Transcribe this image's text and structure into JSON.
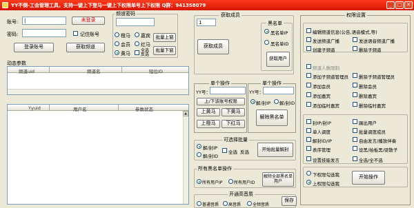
{
  "titlebar": {
    "title": "YY不倒-工会管理工具，支持一键上下登马一键上下权限单号上下权限 Q群：941358079",
    "min_icon": "minimize-icon",
    "max_icon": "maximize-icon",
    "close_icon": "close-icon"
  },
  "login": {
    "account_label": "账号:",
    "password_label": "密码:",
    "account_value": "|",
    "status": "未登录",
    "remember": "记住账号",
    "login_btn": "登录账号",
    "get_channel_btn": "获取频道"
  },
  "channel": {
    "group_title": "频道密码",
    "radios": [
      "橙马",
      "红马",
      "会员",
      "嘉宾",
      "黄马",
      "全选反选"
    ],
    "batch_up": "批量上窗",
    "batch_down": "批量下窗"
  },
  "members": {
    "group_title": "获取成员",
    "id_value": "1",
    "get_btn": "获取成员",
    "blacklist_title": "黑名单",
    "blacklist_ip": "黑名单IP",
    "blacklist_id": "黑名单ID",
    "get_users_btn": "获取用户"
  },
  "dynamic": {
    "title": "动态参数",
    "cols": [
      "频道uid",
      "频道名",
      "短位ID"
    ]
  },
  "lower": {
    "cols": [
      "Yyuid",
      "用户名",
      "参数状态"
    ]
  },
  "single1": {
    "title": "单个操作",
    "yy_label": "YY号：",
    "up_down_btn": "上/下该账号权限",
    "up_horse": "上黄马",
    "down_horse": "下黄马",
    "up_red": "上橙马",
    "down_red": "下红马"
  },
  "single2": {
    "title": "单个操作",
    "yy_label": "YY号：",
    "radio1": "解/封IP",
    "radio2": "解/封ID",
    "unblock_btn": "解除黑名单"
  },
  "batch": {
    "title": "可选择批量",
    "radio1": "解/封IP",
    "radio2": "解/封ID",
    "select_all": "全选",
    "invert": "反选",
    "start_btn": "开始批量解封"
  },
  "all_black": {
    "title": "所有黑名单操作",
    "radio1": "所有用户IP",
    "radio2": "所有用户ID",
    "unblock_all_btn": "解除全部黑名单用户"
  },
  "quality": {
    "title": "开通高音质",
    "radio1": "普通音质",
    "radio2": "高音质",
    "radio3": "全频音质",
    "save_btn": "保存"
  },
  "permissions": {
    "title": "权限设置",
    "top_checks": [
      "编辑频道信息(公告,语音模式,等)",
      "发送频道广播",
      "发送语音频道广播",
      "创建子频道",
      "删除子频道"
    ],
    "sub_title": "频道人数限制",
    "sub_checks": [
      "添加子频道管理员",
      "删除子频道管理员",
      "添加会员",
      "删除会员",
      "添加嘉宾",
      "删除嘉宾",
      "添加临时嘉宾",
      "删除临时嘉宾"
    ],
    "ops_checks": [
      "封IP/封IP",
      "踢出用户",
      "单人调度",
      "批量调度成员",
      "解封ID/IP",
      "自由发言/播放伴奏",
      "表序管理",
      "设黑/拍板黑/驱散子",
      "设置技能发言",
      "全选/全不选"
    ],
    "radio_down": "下权限勾选我",
    "radio_up": "上权限勾选我",
    "start_btn": "开始操作"
  }
}
